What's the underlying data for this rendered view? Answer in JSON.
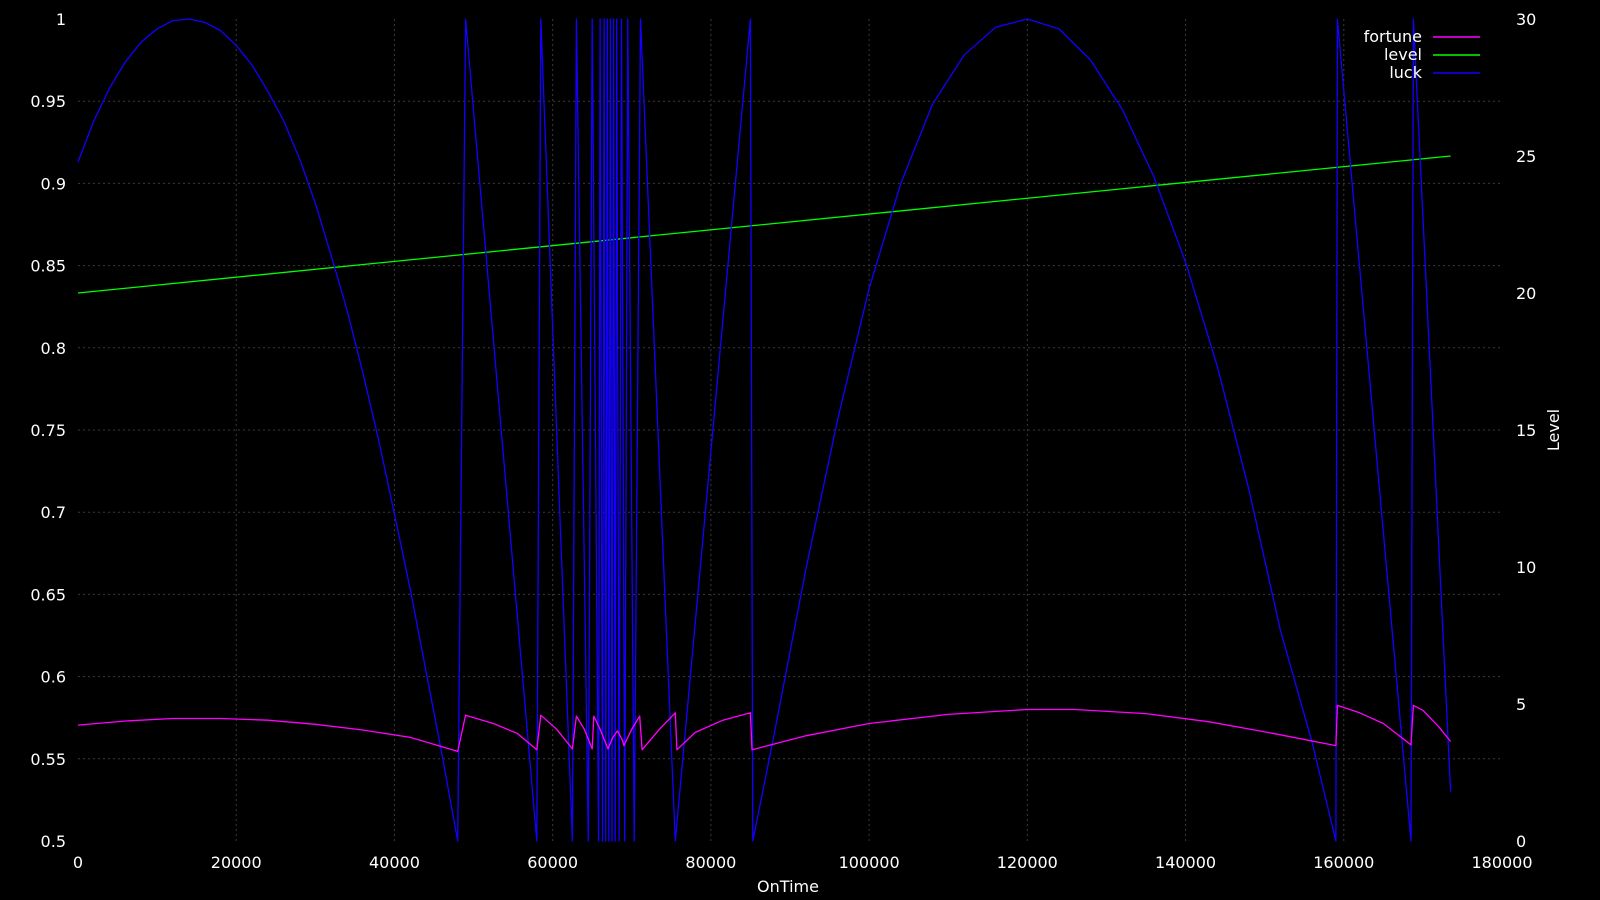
{
  "chart_data": {
    "type": "line",
    "xlabel": "OnTime",
    "ylabel": "",
    "y2label": "Level",
    "xlim": [
      0,
      180000
    ],
    "ylim": [
      0.5,
      1
    ],
    "y2lim": [
      0,
      30
    ],
    "x_ticks": [
      "0",
      "20000",
      "40000",
      "60000",
      "80000",
      "100000",
      "120000",
      "140000",
      "160000",
      "180000"
    ],
    "y_ticks": [
      "0.5",
      "0.55",
      "0.6",
      "0.65",
      "0.7",
      "0.75",
      "0.8",
      "0.85",
      "0.9",
      "0.95",
      "1"
    ],
    "y2_ticks": [
      "0",
      "5",
      "10",
      "15",
      "20",
      "25",
      "30"
    ],
    "grid": true,
    "legend_position": "top-right",
    "series": [
      {
        "name": "fortune",
        "color": "#ff00ff",
        "axis": "left",
        "points": [
          [
            0,
            0.5705
          ],
          [
            6000,
            0.573
          ],
          [
            12000,
            0.5745
          ],
          [
            18000,
            0.5745
          ],
          [
            24000,
            0.5735
          ],
          [
            30000,
            0.571
          ],
          [
            36000,
            0.5675
          ],
          [
            42000,
            0.563
          ],
          [
            48000,
            0.5545
          ],
          [
            49000,
            0.5765
          ],
          [
            52500,
            0.5715
          ],
          [
            55500,
            0.5655
          ],
          [
            58000,
            0.5555
          ],
          [
            58500,
            0.5765
          ],
          [
            60500,
            0.568
          ],
          [
            62500,
            0.556
          ],
          [
            63000,
            0.576
          ],
          [
            64000,
            0.568
          ],
          [
            65000,
            0.556
          ],
          [
            65200,
            0.576
          ],
          [
            66000,
            0.568
          ],
          [
            66500,
            0.562
          ],
          [
            67000,
            0.556
          ],
          [
            67600,
            0.563
          ],
          [
            68200,
            0.567
          ],
          [
            68800,
            0.5615
          ],
          [
            69000,
            0.558
          ],
          [
            70000,
            0.568
          ],
          [
            71000,
            0.576
          ],
          [
            71300,
            0.5555
          ],
          [
            73500,
            0.568
          ],
          [
            75500,
            0.578
          ],
          [
            75700,
            0.5555
          ],
          [
            78000,
            0.566
          ],
          [
            81500,
            0.5735
          ],
          [
            85000,
            0.578
          ],
          [
            85200,
            0.5555
          ],
          [
            92000,
            0.564
          ],
          [
            100000,
            0.5715
          ],
          [
            110000,
            0.577
          ],
          [
            120000,
            0.58
          ],
          [
            126000,
            0.58
          ],
          [
            135000,
            0.5775
          ],
          [
            143000,
            0.5725
          ],
          [
            151000,
            0.5655
          ],
          [
            159000,
            0.558
          ],
          [
            159200,
            0.5825
          ],
          [
            162000,
            0.578
          ],
          [
            165000,
            0.5715
          ],
          [
            168500,
            0.5585
          ],
          [
            168800,
            0.5825
          ],
          [
            170000,
            0.5795
          ],
          [
            172000,
            0.5695
          ],
          [
            173500,
            0.5605
          ]
        ]
      },
      {
        "name": "level",
        "color": "#00ff00",
        "axis": "right",
        "points": [
          [
            0,
            20
          ],
          [
            173500,
            25
          ]
        ]
      },
      {
        "name": "luck",
        "color": "#1400ff",
        "axis": "left",
        "points": [
          [
            0,
            0.913
          ],
          [
            2000,
            0.938
          ],
          [
            4000,
            0.958
          ],
          [
            6000,
            0.974
          ],
          [
            8000,
            0.986
          ],
          [
            10000,
            0.994
          ],
          [
            12000,
            0.999
          ],
          [
            14000,
            1
          ],
          [
            16000,
            0.998
          ],
          [
            18000,
            0.993
          ],
          [
            20000,
            0.984
          ],
          [
            22000,
            0.972
          ],
          [
            24000,
            0.956
          ],
          [
            26000,
            0.938
          ],
          [
            28000,
            0.915
          ],
          [
            30000,
            0.888
          ],
          [
            32000,
            0.856
          ],
          [
            34000,
            0.823
          ],
          [
            36000,
            0.785
          ],
          [
            38000,
            0.744
          ],
          [
            40000,
            0.699
          ],
          [
            42000,
            0.653
          ],
          [
            44000,
            0.603
          ],
          [
            46000,
            0.553
          ],
          [
            48000,
            0.5
          ],
          [
            49000,
            1
          ],
          [
            58000,
            0.5
          ],
          [
            58500,
            1
          ],
          [
            62500,
            0.5
          ],
          [
            63000,
            1
          ],
          [
            64500,
            0.5
          ],
          [
            65000,
            1
          ],
          [
            65800,
            0.5
          ],
          [
            66000,
            1
          ],
          [
            66300,
            0.5
          ],
          [
            66500,
            1
          ],
          [
            66700,
            0.5
          ],
          [
            66900,
            1
          ],
          [
            67100,
            0.5
          ],
          [
            67300,
            1
          ],
          [
            67500,
            0.5
          ],
          [
            67700,
            1
          ],
          [
            67900,
            0.5
          ],
          [
            68100,
            1
          ],
          [
            68400,
            0.5
          ],
          [
            68700,
            1
          ],
          [
            69100,
            0.5
          ],
          [
            69500,
            1
          ],
          [
            70300,
            0.5
          ],
          [
            71100,
            1
          ],
          [
            75500,
            0.5
          ],
          [
            85000,
            1
          ],
          [
            85300,
            0.5
          ],
          [
            88000,
            0.565
          ],
          [
            92000,
            0.665
          ],
          [
            96000,
            0.756
          ],
          [
            100000,
            0.836
          ],
          [
            104000,
            0.9
          ],
          [
            108000,
            0.948
          ],
          [
            112000,
            0.978
          ],
          [
            116000,
            0.995
          ],
          [
            120000,
            1
          ],
          [
            124000,
            0.994
          ],
          [
            128000,
            0.975
          ],
          [
            132000,
            0.945
          ],
          [
            136000,
            0.904
          ],
          [
            140000,
            0.852
          ],
          [
            144000,
            0.789
          ],
          [
            148000,
            0.714
          ],
          [
            152000,
            0.628
          ],
          [
            156000,
            0.56
          ],
          [
            159000,
            0.5
          ],
          [
            159200,
            1
          ],
          [
            168500,
            0.5
          ],
          [
            168800,
            1
          ],
          [
            173500,
            0.53
          ]
        ]
      }
    ]
  }
}
